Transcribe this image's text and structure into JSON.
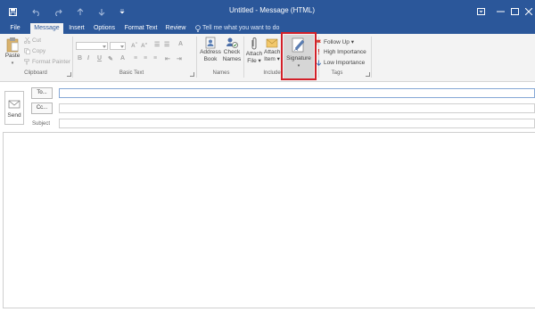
{
  "window": {
    "title": "Untitled - Message (HTML)",
    "accent_color": "#2b579a",
    "highlight_color": "#d32029"
  },
  "quick_access": {
    "icons": [
      "save-icon",
      "undo-icon",
      "redo-icon",
      "up-arrow-icon",
      "down-arrow-icon",
      "customize-icon"
    ]
  },
  "window_controls": {
    "icons": [
      "ribbon-display-options-icon",
      "minimize-icon",
      "maximize-icon",
      "close-icon"
    ]
  },
  "tabs": [
    "File",
    "Message",
    "Insert",
    "Options",
    "Format Text",
    "Review"
  ],
  "active_tab": "Message",
  "tell_me": "Tell me what you want to do",
  "ribbon": {
    "clipboard": {
      "label": "Clipboard",
      "paste": "Paste",
      "cut": "Cut",
      "copy": "Copy",
      "format_painter": "Format Painter"
    },
    "basic_text": {
      "label": "Basic Text",
      "bold": "B",
      "italic": "I",
      "underline": "U"
    },
    "names": {
      "label": "Names",
      "address_book": [
        "Address",
        "Book"
      ],
      "check_names": [
        "Check",
        "Names"
      ]
    },
    "include": {
      "label": "Include",
      "attach_file": [
        "Attach",
        "File ▾"
      ],
      "attach_item": [
        "Attach",
        "Item ▾"
      ],
      "signature": "Signature"
    },
    "tags": {
      "label": "Tags",
      "follow_up": "Follow Up ▾",
      "high_importance": "High Importance",
      "low_importance": "Low Importance"
    }
  },
  "compose": {
    "send": "Send",
    "to_button": "To...",
    "cc_button": "Cc...",
    "subject_label": "Subject",
    "to_value": "",
    "cc_value": "",
    "subject_value": "",
    "body_value": ""
  }
}
